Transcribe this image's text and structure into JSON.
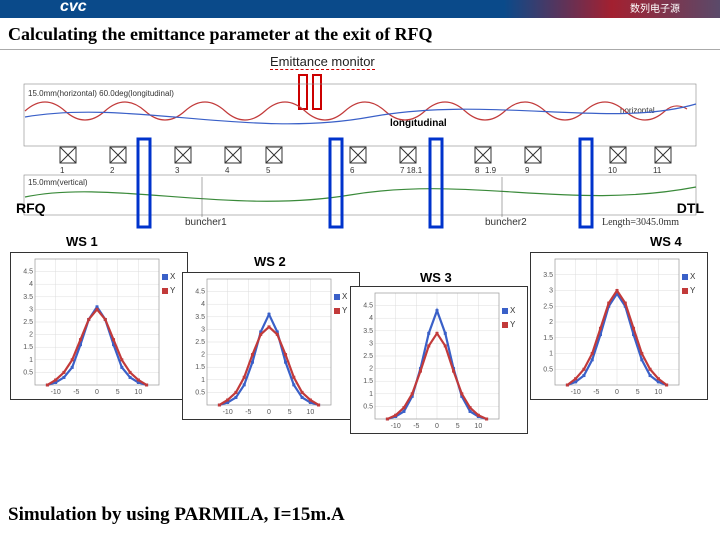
{
  "header": {
    "logo": "cvc",
    "cn_right": "数列电子源"
  },
  "title": "Calculating the emittance  parameter at the exit of RFQ",
  "beamline": {
    "monitor_label": "Emittance monitor",
    "left_end": "RFQ",
    "right_end": "DTL",
    "top_axis_note": "15.0mm(horizontal) 60.0deg(longitudinal)",
    "longitudinal": "longitudinal",
    "horizontal": "horizontal",
    "vertical_note": "15.0mm(vertical)",
    "buncher1": "buncher1",
    "buncher2": "buncher2",
    "length_note": "Length=3045.0mm",
    "ws_positions": [
      "WS1",
      "WS2",
      "WS3",
      "WS4"
    ]
  },
  "ws_captions": {
    "ws1": "WS 1",
    "ws2": "WS 2",
    "ws3": "WS 3",
    "ws4": "WS 4"
  },
  "chart_data": [
    {
      "type": "line",
      "title": "WS 1",
      "xlabel": "",
      "ylabel": "",
      "xlim": [
        -15,
        15
      ],
      "ylim": [
        0,
        5
      ],
      "x_ticks": [
        -10,
        -5,
        0,
        5,
        10
      ],
      "y_ticks": [
        0.5,
        1,
        1.5,
        2,
        2.5,
        3,
        3.5,
        4,
        4.5
      ],
      "series": [
        {
          "name": "X",
          "color": "#3a60c8",
          "x": [
            -12,
            -10,
            -8,
            -6,
            -4,
            -2,
            0,
            2,
            4,
            6,
            8,
            10,
            12
          ],
          "values": [
            0,
            0.1,
            0.3,
            0.7,
            1.6,
            2.6,
            3.1,
            2.6,
            1.6,
            0.7,
            0.3,
            0.1,
            0
          ]
        },
        {
          "name": "Y",
          "color": "#c23a3a",
          "x": [
            -12,
            -10,
            -8,
            -6,
            -4,
            -2,
            0,
            2,
            4,
            6,
            8,
            10,
            12
          ],
          "values": [
            0,
            0.2,
            0.5,
            1.0,
            1.8,
            2.6,
            3.0,
            2.6,
            1.8,
            1.0,
            0.5,
            0.2,
            0
          ]
        }
      ]
    },
    {
      "type": "line",
      "title": "WS 2",
      "xlabel": "",
      "ylabel": "",
      "xlim": [
        -15,
        15
      ],
      "ylim": [
        0,
        5
      ],
      "x_ticks": [
        -10,
        -5,
        0,
        5,
        10
      ],
      "y_ticks": [
        0.5,
        1,
        1.5,
        2,
        2.5,
        3,
        3.5,
        4,
        4.5
      ],
      "series": [
        {
          "name": "X",
          "color": "#3a60c8",
          "x": [
            -12,
            -10,
            -8,
            -6,
            -4,
            -2,
            0,
            2,
            4,
            6,
            8,
            10,
            12
          ],
          "values": [
            0,
            0.1,
            0.3,
            0.8,
            1.7,
            2.9,
            3.6,
            2.9,
            1.7,
            0.8,
            0.3,
            0.1,
            0
          ]
        },
        {
          "name": "Y",
          "color": "#c23a3a",
          "x": [
            -12,
            -10,
            -8,
            -6,
            -4,
            -2,
            0,
            2,
            4,
            6,
            8,
            10,
            12
          ],
          "values": [
            0,
            0.2,
            0.5,
            1.1,
            2.0,
            2.8,
            3.1,
            2.8,
            2.0,
            1.1,
            0.5,
            0.2,
            0
          ]
        }
      ]
    },
    {
      "type": "line",
      "title": "WS 3",
      "xlabel": "",
      "ylabel": "",
      "xlim": [
        -15,
        15
      ],
      "ylim": [
        0,
        5
      ],
      "x_ticks": [
        -10,
        -5,
        0,
        5,
        10
      ],
      "y_ticks": [
        0.5,
        1,
        1.5,
        2,
        2.5,
        3,
        3.5,
        4,
        4.5
      ],
      "series": [
        {
          "name": "X",
          "color": "#3a60c8",
          "x": [
            -12,
            -10,
            -8,
            -6,
            -4,
            -2,
            0,
            2,
            4,
            6,
            8,
            10,
            12
          ],
          "values": [
            0,
            0.1,
            0.3,
            0.9,
            2.0,
            3.4,
            4.3,
            3.4,
            2.0,
            0.9,
            0.3,
            0.1,
            0
          ]
        },
        {
          "name": "Y",
          "color": "#c23a3a",
          "x": [
            -12,
            -10,
            -8,
            -6,
            -4,
            -2,
            0,
            2,
            4,
            6,
            8,
            10,
            12
          ],
          "values": [
            0,
            0.15,
            0.45,
            1.0,
            1.9,
            2.9,
            3.4,
            2.9,
            1.9,
            1.0,
            0.45,
            0.15,
            0
          ]
        }
      ]
    },
    {
      "type": "line",
      "title": "WS 4",
      "xlabel": "",
      "ylabel": "",
      "xlim": [
        -15,
        15
      ],
      "ylim": [
        0,
        4
      ],
      "x_ticks": [
        -10,
        -5,
        0,
        5,
        10
      ],
      "y_ticks": [
        0.5,
        1,
        1.5,
        2,
        2.5,
        3,
        3.5
      ],
      "series": [
        {
          "name": "X",
          "color": "#3a60c8",
          "x": [
            -12,
            -10,
            -8,
            -6,
            -4,
            -2,
            0,
            2,
            4,
            6,
            8,
            10,
            12
          ],
          "values": [
            0,
            0.1,
            0.3,
            0.8,
            1.6,
            2.5,
            2.9,
            2.5,
            1.6,
            0.8,
            0.3,
            0.1,
            0
          ]
        },
        {
          "name": "Y",
          "color": "#c23a3a",
          "x": [
            -12,
            -10,
            -8,
            -6,
            -4,
            -2,
            0,
            2,
            4,
            6,
            8,
            10,
            12
          ],
          "values": [
            0,
            0.2,
            0.5,
            1.0,
            1.8,
            2.6,
            3.0,
            2.6,
            1.8,
            1.0,
            0.5,
            0.2,
            0
          ]
        }
      ]
    }
  ],
  "footer": "Simulation by using PARMILA, I=15m.A"
}
